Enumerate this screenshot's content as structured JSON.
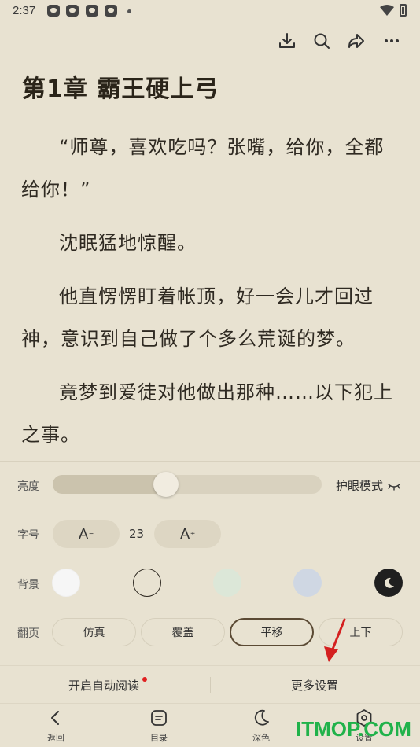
{
  "status_bar": {
    "time": "2:37"
  },
  "top_actions": [
    "download-icon",
    "search-icon",
    "share-icon",
    "more-icon"
  ],
  "chapter": {
    "title": "第1章 霸王硬上弓",
    "paragraphs": [
      "“师尊，喜欢吃吗？张嘴，给你，全都给你！”",
      "沈眠猛地惊醒。",
      "他直愣愣盯着帐顶，好一会儿才回过神，意识到自己做了个多么荒诞的梦。",
      "竟梦到爱徒对他做出那种……以下犯上之事。"
    ]
  },
  "settings": {
    "brightness": {
      "label": "亮度",
      "level": 0.42,
      "eye_mode_label": "护眼模式"
    },
    "font": {
      "label": "字号",
      "decrease": "A",
      "decrease_sup": "−",
      "size": "23",
      "increase": "A",
      "increase_sup": "+"
    },
    "background": {
      "label": "背景",
      "swatches": [
        "#f6f6f6",
        "#e8e2d1",
        "#dce7d8",
        "#cfd7e3",
        "#1f1f1f"
      ],
      "selected_index": 1
    },
    "page_turn": {
      "label": "翻页",
      "options": [
        "仿真",
        "覆盖",
        "平移",
        "上下"
      ],
      "selected_index": 2
    },
    "auto_read_label": "开启自动阅读",
    "more_settings_label": "更多设置"
  },
  "nav": {
    "items": [
      {
        "label": "返回",
        "icon": "back-icon"
      },
      {
        "label": "目录",
        "icon": "catalog-icon"
      },
      {
        "label": "深色",
        "icon": "moon-icon"
      },
      {
        "label": "设置",
        "icon": "settings-icon"
      }
    ]
  },
  "watermark": "ITMOP.COM",
  "colors": {
    "accent": "#5b4a34",
    "background": "#e8e2d1",
    "badge": "#e02020",
    "watermark": "#20b24a",
    "arrow": "#d42020"
  }
}
